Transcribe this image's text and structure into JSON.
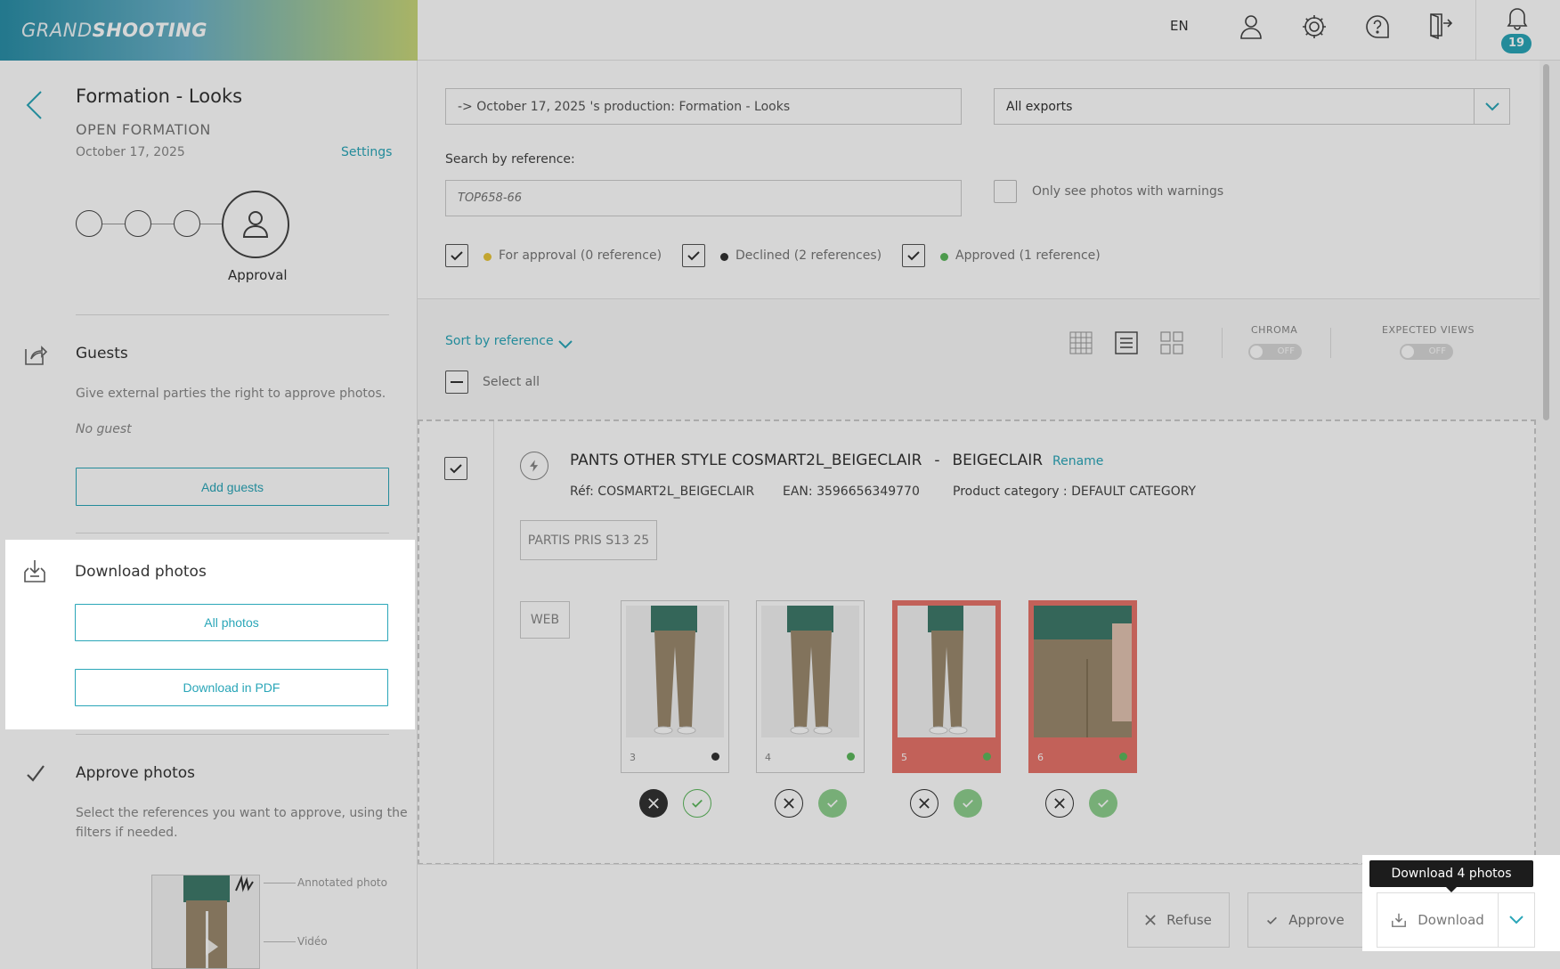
{
  "logo": {
    "part1": "GRAND",
    "part2": "SHOOTING"
  },
  "topbar": {
    "language": "EN",
    "notifications_count": "19"
  },
  "sidebar": {
    "title": "Formation - Looks",
    "subtitle": "OPEN FORMATION",
    "date": "October 17, 2025",
    "settings_label": "Settings",
    "workflow_current_step": "Approval",
    "guests": {
      "title": "Guests",
      "description": "Give external parties the right to approve photos.",
      "empty": "No guest",
      "add_button": "Add guests"
    },
    "download": {
      "title": "Download photos",
      "all_button": "All photos",
      "pdf_button": "Download in PDF"
    },
    "approve": {
      "title": "Approve photos",
      "description_line1": "Select the references you want to approve, using the",
      "description_line2": "filters if needed.",
      "legend_annotated": "Annotated photo",
      "legend_video": "Vidéo"
    }
  },
  "filters": {
    "production_value": "-> October 17, 2025 's production: Formation - Looks",
    "exports_value": "All exports",
    "search_label": "Search by reference:",
    "search_placeholder": "TOP658-66",
    "warnings_label": "Only see photos with warnings",
    "statuses": [
      {
        "label": "For approval (0 reference)",
        "color": "#e8c53a"
      },
      {
        "label": "Declined (2 references)",
        "color": "#333333"
      },
      {
        "label": "Approved (1 reference)",
        "color": "#5cb85c"
      }
    ]
  },
  "toolbar": {
    "sort_label": "Sort by reference",
    "select_all": "Select all",
    "chroma_label": "CHROMA",
    "chroma_value": "OFF",
    "expected_label": "EXPECTED VIEWS",
    "expected_value": "OFF"
  },
  "product": {
    "name": "PANTS OTHER STYLE COSMART2L_BEIGECLAIR",
    "separator": "-",
    "color": "BEIGECLAIR",
    "rename": "Rename",
    "ref": "Réf: COSMART2L_BEIGECLAIR",
    "ean": "EAN: 3596656349770",
    "category": "Product category : DEFAULT CATEGORY",
    "collection_tag": "PARTIS PRIS S13 25",
    "channel_tag": "WEB",
    "photos": [
      {
        "number": "3",
        "status_color": "#333333",
        "warning": false
      },
      {
        "number": "4",
        "status_color": "#5cb85c",
        "warning": false
      },
      {
        "number": "5",
        "status_color": "#5cb85c",
        "warning": true
      },
      {
        "number": "6",
        "status_color": "#5cb85c",
        "warning": true
      }
    ]
  },
  "actions": {
    "refuse": "Refuse",
    "approve": "Approve",
    "download": "Download",
    "tooltip": "Download 4 photos"
  },
  "colors": {
    "accent": "#2aa6b8",
    "warning": "#e8746a"
  }
}
